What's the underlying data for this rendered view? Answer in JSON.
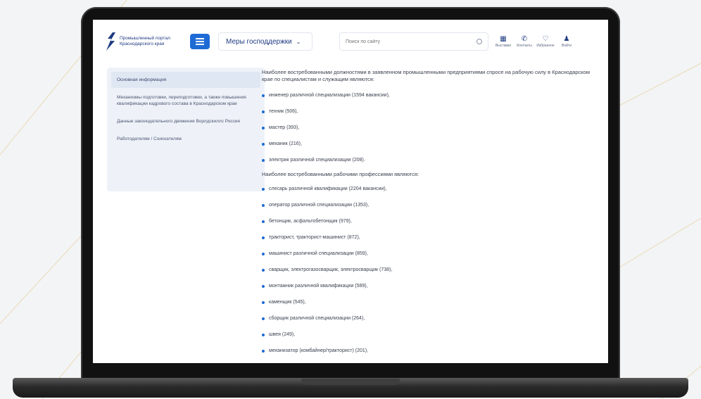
{
  "header": {
    "logo_text": [
      "Промышленный портал",
      "Краснодарского края"
    ],
    "support_label": "Меры господдержки",
    "search_placeholder": "Поиск по сайту",
    "actions": [
      {
        "label": "Выставки",
        "icon": "calendar-icon"
      },
      {
        "label": "Контакты",
        "icon": "phone-icon"
      },
      {
        "label": "Избранное",
        "icon": "heart-icon"
      },
      {
        "label": "Войти",
        "icon": "user-icon"
      }
    ]
  },
  "sidebar": {
    "items": [
      {
        "label": "Основная информация",
        "active": true
      },
      {
        "label": "Механизмы подготовки, переподготовки, а также повышения квалификации кадрового состава в Краснодарском крае",
        "active": false
      },
      {
        "label": "Данные законодательного движения Ворлдскиллс Россия",
        "active": false
      },
      {
        "label": "Работодателям / Соискателям",
        "active": false
      }
    ]
  },
  "content": {
    "intro": "Наиболее востребованными должностями в заявленном промышленными предприятиями спросе на рабочую силу в Краснодарском крае по специалистам и служащим являются:",
    "positions": [
      "инженер различной специализации (1594 вакансии),",
      "техник (506),",
      "мастер (393),",
      "механик (216),",
      "электрик различной специализации (208)."
    ],
    "intro2": "Наиболее востребованными рабочими профессиями являются:",
    "professions": [
      "слесарь различной квалификации (2204 вакансии),",
      "оператор различной специализации (1353),",
      "бетонщик, асфальтобетонщик (979),",
      "тракторист, тракторист-машинист (872),",
      "машинист различной специализации (859),",
      "сварщик, электрогазосварщик, электросварщик (738),",
      "монтажник различной квалификации (589),",
      "каменщик (545),",
      "сборщик различной специализации (264),",
      "швея (249),",
      "механизатор (комбайнер/тракторист) (201),"
    ]
  },
  "colors": {
    "accent": "#1e6bd6",
    "text_dark": "#1f3b82",
    "sidebar_bg": "#eef2f8"
  }
}
